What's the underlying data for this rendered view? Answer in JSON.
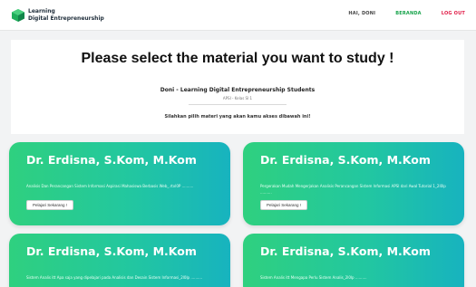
{
  "navbar": {
    "brand_line1": "Learning",
    "brand_line2": "Digital Entrepreneurship",
    "links": {
      "user": "HAI, DONI",
      "home": "BERANDA",
      "logout": "LOG OUT"
    }
  },
  "header": {
    "title": "Please select the material you want to study !",
    "student": "Doni - Learning Digital Entrepreneurship Students",
    "class_info": "APSI - Kelas SI 1",
    "instruction": "Silahkan pilih materi yang akan kamu akses dibawah ini!"
  },
  "materials": [
    {
      "lecturer": "Dr. Erdisna, S.Kom, M.Kom",
      "description": "Analisis Dan Perancangan Sistem Informasi Aspirasi Mahasiswa Berbasis Web_.rtxl0P ..........",
      "button": "Pelajari Sekarang !"
    },
    {
      "lecturer": "Dr. Erdisna, S.Kom, M.Kom",
      "description": "Pergerakan Mudah Mengerjakan Analisis Perancangan Sistem Informasi APSI dari Awal Tutorial 1_2l0lp ..........",
      "button": "Pelajari Sekarang !"
    },
    {
      "lecturer": "Dr. Erdisna, S.Kom, M.Kom",
      "description": "Sistem Analis itt Apa saja yang dipelajari pada Analisis dan Desain Sistem Informasi_2l0lp ..........",
      "button": ""
    },
    {
      "lecturer": "Dr. Erdisna, S.Kom, M.Kom",
      "description": "Sistem Analis itt Mengapa Perlu Sistem Analis_2l0lp ..........",
      "button": ""
    }
  ],
  "icons": {
    "logo": "learning-logo-icon"
  },
  "colors": {
    "accent_green": "#16a34a",
    "logout_red": "#e11d48",
    "card_gradient_start": "#2fd07f",
    "card_gradient_end": "#17b3bf"
  }
}
